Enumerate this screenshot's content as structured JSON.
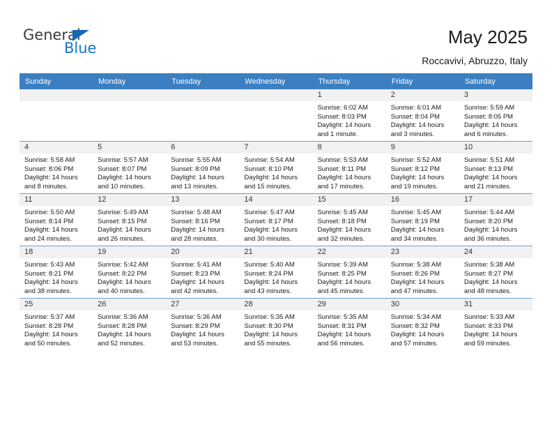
{
  "brand": {
    "name_dark": "General",
    "name_blue": "Blue",
    "accent_color": "#1875c9",
    "header_color": "#3c7fc1"
  },
  "header": {
    "title": "May 2025",
    "subtitle": "Roccavivi, Abruzzo, Italy"
  },
  "calendar": {
    "weekday_headers": [
      "Sunday",
      "Monday",
      "Tuesday",
      "Wednesday",
      "Thursday",
      "Friday",
      "Saturday"
    ],
    "weeks": [
      [
        {
          "day": "",
          "empty": true
        },
        {
          "day": "",
          "empty": true
        },
        {
          "day": "",
          "empty": true
        },
        {
          "day": "",
          "empty": true
        },
        {
          "day": "1",
          "sunrise": "Sunrise: 6:02 AM",
          "sunset": "Sunset: 8:03 PM",
          "daylight": "Daylight: 14 hours and 1 minute."
        },
        {
          "day": "2",
          "sunrise": "Sunrise: 6:01 AM",
          "sunset": "Sunset: 8:04 PM",
          "daylight": "Daylight: 14 hours and 3 minutes."
        },
        {
          "day": "3",
          "sunrise": "Sunrise: 5:59 AM",
          "sunset": "Sunset: 8:05 PM",
          "daylight": "Daylight: 14 hours and 6 minutes."
        }
      ],
      [
        {
          "day": "4",
          "sunrise": "Sunrise: 5:58 AM",
          "sunset": "Sunset: 8:06 PM",
          "daylight": "Daylight: 14 hours and 8 minutes."
        },
        {
          "day": "5",
          "sunrise": "Sunrise: 5:57 AM",
          "sunset": "Sunset: 8:07 PM",
          "daylight": "Daylight: 14 hours and 10 minutes."
        },
        {
          "day": "6",
          "sunrise": "Sunrise: 5:55 AM",
          "sunset": "Sunset: 8:09 PM",
          "daylight": "Daylight: 14 hours and 13 minutes."
        },
        {
          "day": "7",
          "sunrise": "Sunrise: 5:54 AM",
          "sunset": "Sunset: 8:10 PM",
          "daylight": "Daylight: 14 hours and 15 minutes."
        },
        {
          "day": "8",
          "sunrise": "Sunrise: 5:53 AM",
          "sunset": "Sunset: 8:11 PM",
          "daylight": "Daylight: 14 hours and 17 minutes."
        },
        {
          "day": "9",
          "sunrise": "Sunrise: 5:52 AM",
          "sunset": "Sunset: 8:12 PM",
          "daylight": "Daylight: 14 hours and 19 minutes."
        },
        {
          "day": "10",
          "sunrise": "Sunrise: 5:51 AM",
          "sunset": "Sunset: 8:13 PM",
          "daylight": "Daylight: 14 hours and 21 minutes."
        }
      ],
      [
        {
          "day": "11",
          "sunrise": "Sunrise: 5:50 AM",
          "sunset": "Sunset: 8:14 PM",
          "daylight": "Daylight: 14 hours and 24 minutes."
        },
        {
          "day": "12",
          "sunrise": "Sunrise: 5:49 AM",
          "sunset": "Sunset: 8:15 PM",
          "daylight": "Daylight: 14 hours and 26 minutes."
        },
        {
          "day": "13",
          "sunrise": "Sunrise: 5:48 AM",
          "sunset": "Sunset: 8:16 PM",
          "daylight": "Daylight: 14 hours and 28 minutes."
        },
        {
          "day": "14",
          "sunrise": "Sunrise: 5:47 AM",
          "sunset": "Sunset: 8:17 PM",
          "daylight": "Daylight: 14 hours and 30 minutes."
        },
        {
          "day": "15",
          "sunrise": "Sunrise: 5:45 AM",
          "sunset": "Sunset: 8:18 PM",
          "daylight": "Daylight: 14 hours and 32 minutes."
        },
        {
          "day": "16",
          "sunrise": "Sunrise: 5:45 AM",
          "sunset": "Sunset: 8:19 PM",
          "daylight": "Daylight: 14 hours and 34 minutes."
        },
        {
          "day": "17",
          "sunrise": "Sunrise: 5:44 AM",
          "sunset": "Sunset: 8:20 PM",
          "daylight": "Daylight: 14 hours and 36 minutes."
        }
      ],
      [
        {
          "day": "18",
          "sunrise": "Sunrise: 5:43 AM",
          "sunset": "Sunset: 8:21 PM",
          "daylight": "Daylight: 14 hours and 38 minutes."
        },
        {
          "day": "19",
          "sunrise": "Sunrise: 5:42 AM",
          "sunset": "Sunset: 8:22 PM",
          "daylight": "Daylight: 14 hours and 40 minutes."
        },
        {
          "day": "20",
          "sunrise": "Sunrise: 5:41 AM",
          "sunset": "Sunset: 8:23 PM",
          "daylight": "Daylight: 14 hours and 42 minutes."
        },
        {
          "day": "21",
          "sunrise": "Sunrise: 5:40 AM",
          "sunset": "Sunset: 8:24 PM",
          "daylight": "Daylight: 14 hours and 43 minutes."
        },
        {
          "day": "22",
          "sunrise": "Sunrise: 5:39 AM",
          "sunset": "Sunset: 8:25 PM",
          "daylight": "Daylight: 14 hours and 45 minutes."
        },
        {
          "day": "23",
          "sunrise": "Sunrise: 5:38 AM",
          "sunset": "Sunset: 8:26 PM",
          "daylight": "Daylight: 14 hours and 47 minutes."
        },
        {
          "day": "24",
          "sunrise": "Sunrise: 5:38 AM",
          "sunset": "Sunset: 8:27 PM",
          "daylight": "Daylight: 14 hours and 48 minutes."
        }
      ],
      [
        {
          "day": "25",
          "sunrise": "Sunrise: 5:37 AM",
          "sunset": "Sunset: 8:28 PM",
          "daylight": "Daylight: 14 hours and 50 minutes."
        },
        {
          "day": "26",
          "sunrise": "Sunrise: 5:36 AM",
          "sunset": "Sunset: 8:28 PM",
          "daylight": "Daylight: 14 hours and 52 minutes."
        },
        {
          "day": "27",
          "sunrise": "Sunrise: 5:36 AM",
          "sunset": "Sunset: 8:29 PM",
          "daylight": "Daylight: 14 hours and 53 minutes."
        },
        {
          "day": "28",
          "sunrise": "Sunrise: 5:35 AM",
          "sunset": "Sunset: 8:30 PM",
          "daylight": "Daylight: 14 hours and 55 minutes."
        },
        {
          "day": "29",
          "sunrise": "Sunrise: 5:35 AM",
          "sunset": "Sunset: 8:31 PM",
          "daylight": "Daylight: 14 hours and 56 minutes."
        },
        {
          "day": "30",
          "sunrise": "Sunrise: 5:34 AM",
          "sunset": "Sunset: 8:32 PM",
          "daylight": "Daylight: 14 hours and 57 minutes."
        },
        {
          "day": "31",
          "sunrise": "Sunrise: 5:33 AM",
          "sunset": "Sunset: 8:33 PM",
          "daylight": "Daylight: 14 hours and 59 minutes."
        }
      ]
    ]
  }
}
